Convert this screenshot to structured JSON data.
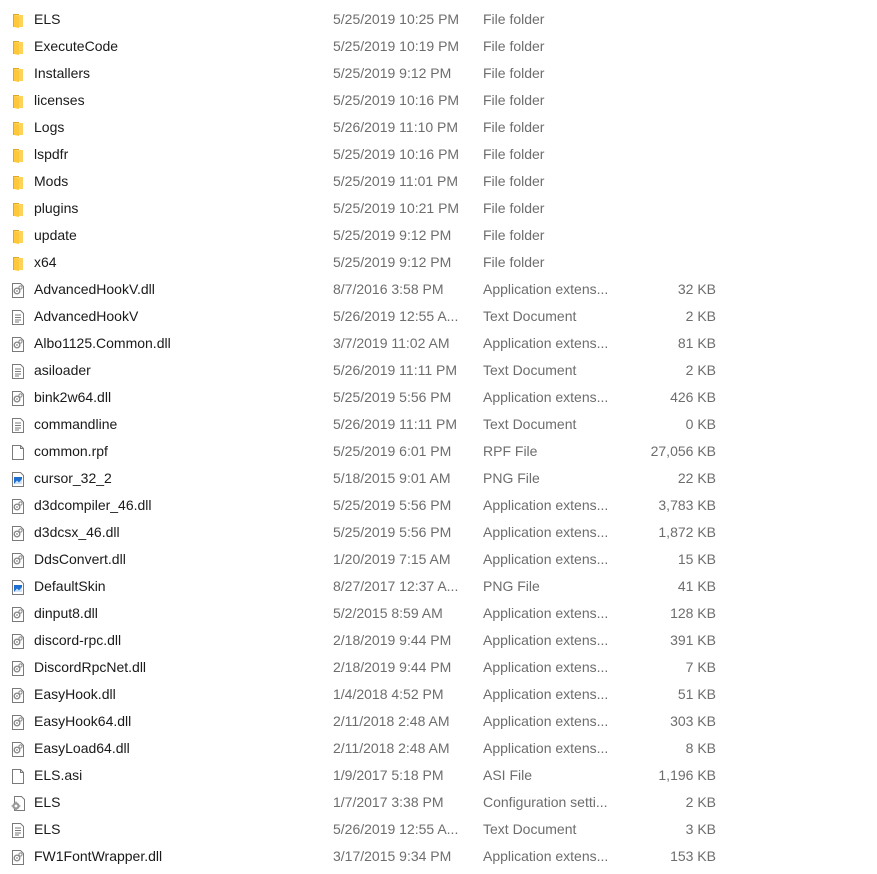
{
  "colors": {
    "folder": "#ffd35a",
    "folder_dark": "#e0a823",
    "text": "#1a1a1a",
    "muted": "#6d6d6d",
    "png_blue": "#1e6fd0"
  },
  "files": [
    {
      "name": "ELS",
      "date": "5/25/2019 10:25 PM",
      "type": "File folder",
      "size": "",
      "icon": "folder-icon"
    },
    {
      "name": "ExecuteCode",
      "date": "5/25/2019 10:19 PM",
      "type": "File folder",
      "size": "",
      "icon": "folder-icon"
    },
    {
      "name": "Installers",
      "date": "5/25/2019 9:12 PM",
      "type": "File folder",
      "size": "",
      "icon": "folder-icon"
    },
    {
      "name": "licenses",
      "date": "5/25/2019 10:16 PM",
      "type": "File folder",
      "size": "",
      "icon": "folder-icon"
    },
    {
      "name": "Logs",
      "date": "5/26/2019 11:10 PM",
      "type": "File folder",
      "size": "",
      "icon": "folder-icon"
    },
    {
      "name": "lspdfr",
      "date": "5/25/2019 10:16 PM",
      "type": "File folder",
      "size": "",
      "icon": "folder-icon"
    },
    {
      "name": "Mods",
      "date": "5/25/2019 11:01 PM",
      "type": "File folder",
      "size": "",
      "icon": "folder-icon"
    },
    {
      "name": "plugins",
      "date": "5/25/2019 10:21 PM",
      "type": "File folder",
      "size": "",
      "icon": "folder-icon"
    },
    {
      "name": "update",
      "date": "5/25/2019 9:12 PM",
      "type": "File folder",
      "size": "",
      "icon": "folder-icon"
    },
    {
      "name": "x64",
      "date": "5/25/2019 9:12 PM",
      "type": "File folder",
      "size": "",
      "icon": "folder-icon"
    },
    {
      "name": "AdvancedHookV.dll",
      "date": "8/7/2016 3:58 PM",
      "type": "Application extens...",
      "size": "32 KB",
      "icon": "dll-file-icon"
    },
    {
      "name": "AdvancedHookV",
      "date": "5/26/2019 12:55 A...",
      "type": "Text Document",
      "size": "2 KB",
      "icon": "text-file-icon"
    },
    {
      "name": "Albo1125.Common.dll",
      "date": "3/7/2019 11:02 AM",
      "type": "Application extens...",
      "size": "81 KB",
      "icon": "dll-file-icon"
    },
    {
      "name": "asiloader",
      "date": "5/26/2019 11:11 PM",
      "type": "Text Document",
      "size": "2 KB",
      "icon": "text-file-icon"
    },
    {
      "name": "bink2w64.dll",
      "date": "5/25/2019 5:56 PM",
      "type": "Application extens...",
      "size": "426 KB",
      "icon": "dll-file-icon"
    },
    {
      "name": "commandline",
      "date": "5/26/2019 11:11 PM",
      "type": "Text Document",
      "size": "0 KB",
      "icon": "text-file-icon"
    },
    {
      "name": "common.rpf",
      "date": "5/25/2019 6:01 PM",
      "type": "RPF File",
      "size": "27,056 KB",
      "icon": "blank-file-icon"
    },
    {
      "name": "cursor_32_2",
      "date": "5/18/2015 9:01 AM",
      "type": "PNG File",
      "size": "22 KB",
      "icon": "png-file-icon"
    },
    {
      "name": "d3dcompiler_46.dll",
      "date": "5/25/2019 5:56 PM",
      "type": "Application extens...",
      "size": "3,783 KB",
      "icon": "dll-file-icon"
    },
    {
      "name": "d3dcsx_46.dll",
      "date": "5/25/2019 5:56 PM",
      "type": "Application extens...",
      "size": "1,872 KB",
      "icon": "dll-file-icon"
    },
    {
      "name": "DdsConvert.dll",
      "date": "1/20/2019 7:15 AM",
      "type": "Application extens...",
      "size": "15 KB",
      "icon": "dll-file-icon"
    },
    {
      "name": "DefaultSkin",
      "date": "8/27/2017 12:37 A...",
      "type": "PNG File",
      "size": "41 KB",
      "icon": "png-file-icon"
    },
    {
      "name": "dinput8.dll",
      "date": "5/2/2015 8:59 AM",
      "type": "Application extens...",
      "size": "128 KB",
      "icon": "dll-file-icon"
    },
    {
      "name": "discord-rpc.dll",
      "date": "2/18/2019 9:44 PM",
      "type": "Application extens...",
      "size": "391 KB",
      "icon": "dll-file-icon"
    },
    {
      "name": "DiscordRpcNet.dll",
      "date": "2/18/2019 9:44 PM",
      "type": "Application extens...",
      "size": "7 KB",
      "icon": "dll-file-icon"
    },
    {
      "name": "EasyHook.dll",
      "date": "1/4/2018 4:52 PM",
      "type": "Application extens...",
      "size": "51 KB",
      "icon": "dll-file-icon"
    },
    {
      "name": "EasyHook64.dll",
      "date": "2/11/2018 2:48 AM",
      "type": "Application extens...",
      "size": "303 KB",
      "icon": "dll-file-icon"
    },
    {
      "name": "EasyLoad64.dll",
      "date": "2/11/2018 2:48 AM",
      "type": "Application extens...",
      "size": "8 KB",
      "icon": "dll-file-icon"
    },
    {
      "name": "ELS.asi",
      "date": "1/9/2017 5:18 PM",
      "type": "ASI File",
      "size": "1,196 KB",
      "icon": "blank-file-icon"
    },
    {
      "name": "ELS",
      "date": "1/7/2017 3:38 PM",
      "type": "Configuration setti...",
      "size": "2 KB",
      "icon": "config-file-icon"
    },
    {
      "name": "ELS",
      "date": "5/26/2019 12:55 A...",
      "type": "Text Document",
      "size": "3 KB",
      "icon": "text-file-icon"
    },
    {
      "name": "FW1FontWrapper.dll",
      "date": "3/17/2015 9:34 PM",
      "type": "Application extens...",
      "size": "153 KB",
      "icon": "dll-file-icon"
    }
  ]
}
